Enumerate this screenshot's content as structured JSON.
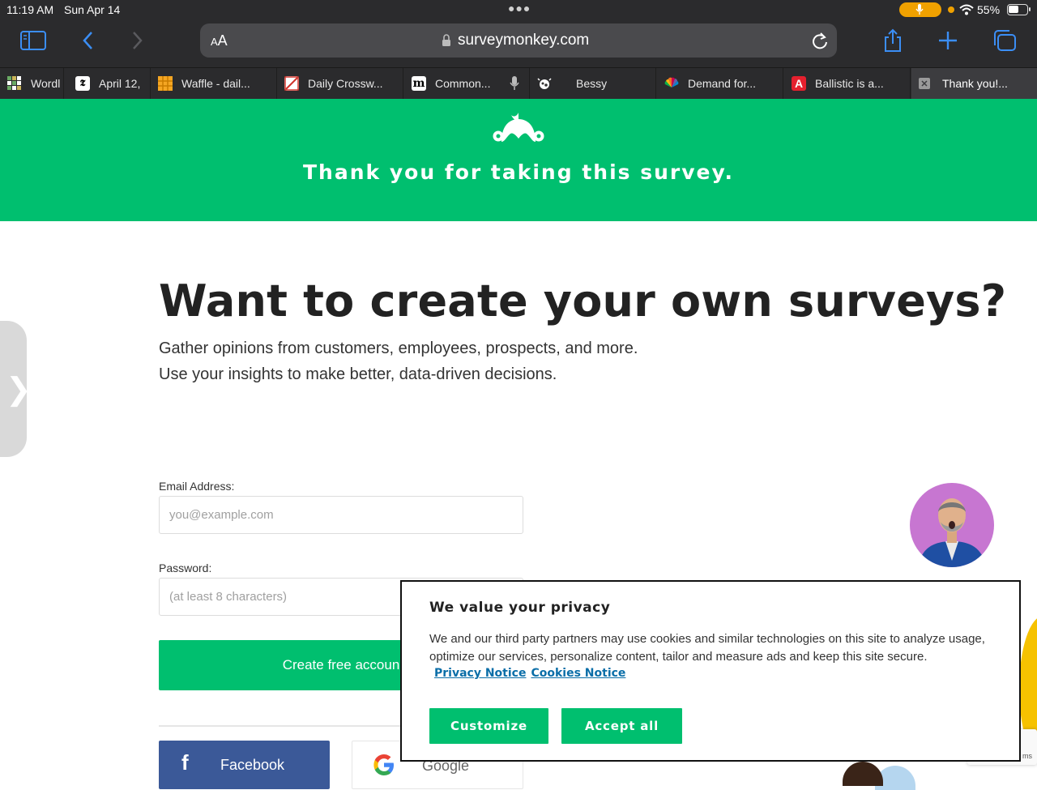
{
  "status": {
    "time": "11:19 AM",
    "date": "Sun Apr 14",
    "battery": "55%",
    "battery_level": 0.55
  },
  "browser": {
    "url": "surveymonkey.com",
    "text_size_label_small": "A",
    "text_size_label_large": "A",
    "tabs": [
      {
        "label": "Wordl",
        "icon": "wordle-grid-icon",
        "color": "#6aaa64"
      },
      {
        "label": "April 12,",
        "icon": "nyt-logo-icon",
        "color": "#ffffff"
      },
      {
        "label": "Waffle - dail...",
        "icon": "waffle-icon",
        "color": "#f5a623"
      },
      {
        "label": "Daily Crossw...",
        "icon": "crossword-icon",
        "color": "#ffffff"
      },
      {
        "label": "Common...",
        "icon": "medium-logo-icon",
        "color": "#000000"
      },
      {
        "label": "Bessy",
        "icon": "cow-icon",
        "color": "#ffffff"
      },
      {
        "label": "Demand for...",
        "icon": "nbc-peacock-icon",
        "color": "#ffffff"
      },
      {
        "label": "Ballistic is a...",
        "icon": "atari-logo-icon",
        "color": "#e5202e"
      },
      {
        "label": "Thank you!...",
        "icon": "close-tab-icon",
        "color": "#9a9a9a"
      }
    ]
  },
  "hero": {
    "title": "Thank you for taking this survey."
  },
  "main": {
    "headline": "Want to create your own surveys?",
    "sub_line_1": "Gather opinions from customers, employees, prospects, and more.",
    "sub_line_2": "Use your insights to make better, data-driven decisions."
  },
  "form": {
    "email_label": "Email Address:",
    "email_placeholder": "you@example.com",
    "password_label": "Password:",
    "password_placeholder": "(at least 8 characters)",
    "create_button": "Create free accoun",
    "facebook_button": "Facebook",
    "google_button": "Google"
  },
  "cookie": {
    "title": "We value your privacy",
    "text": "We and our third party partners may use cookies and similar technologies on this site to analyze usage, optimize our services, personalize content, tailor and measure ads and keep this site secure.",
    "privacy_link": "Privacy Notice",
    "cookies_link": "Cookies Notice",
    "customize_button": "Customize",
    "accept_button": "Accept all"
  },
  "recaptcha_fragment": "ms",
  "colors": {
    "brand_green": "#00bf6f",
    "facebook_blue": "#3b5998",
    "link_blue": "#0a6ea8",
    "chrome_dark": "#2b2b2d"
  }
}
